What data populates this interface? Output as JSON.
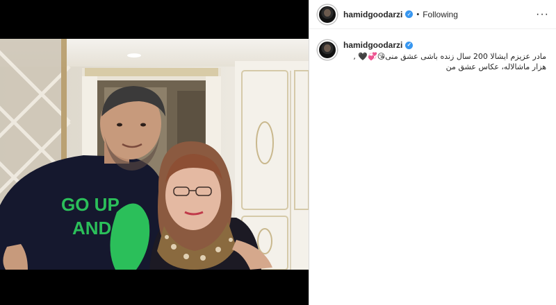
{
  "post": {
    "username": "hamidgoodarzi",
    "verified_badge": "✓",
    "separator": "•",
    "follow_status": "Following",
    "more_icon": "···"
  },
  "caption": {
    "username": "hamidgoodarzi",
    "verified_badge": "✓",
    "line1": "مادر عزیزم ایشالا 200 سال زنده باشی عشق منی😘💞🖤 ,",
    "line2": "هزار ماشالاله، عکاس عشق من"
  },
  "photo": {
    "shirt_text_line1": "GO UP",
    "shirt_text_line2": "AND",
    "colors": {
      "shirt": "#15182e",
      "shirt_print": "#2bbf5a",
      "scarf": "#8a6a3f",
      "wall": "#efece4"
    }
  }
}
